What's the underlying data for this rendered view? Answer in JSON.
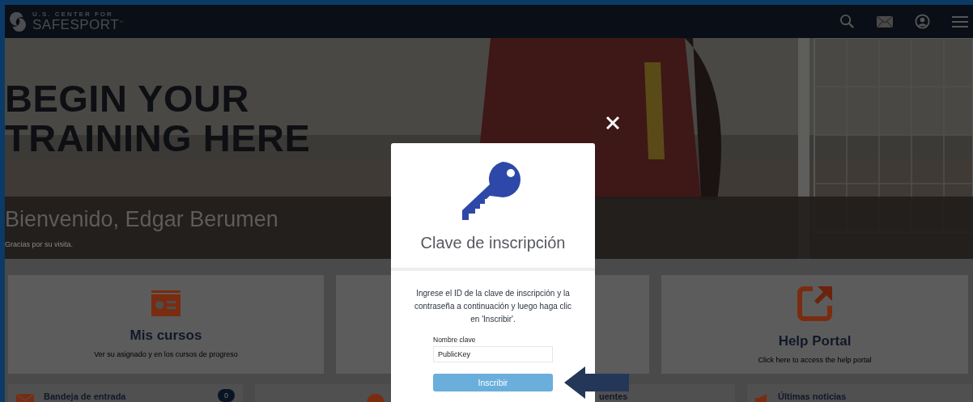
{
  "header": {
    "logo_top": "U.S. CENTER FOR",
    "logo_bottom": "SAFESPORT$^{™}$"
  },
  "hero": {
    "headline": [
      "BEGIN YOUR",
      "TRAINING HERE"
    ],
    "welcome": "Bienvenido, Edgar Berumen",
    "subtitle": "Gracias por su visita."
  },
  "tiles": [
    {
      "kind": "courses",
      "title": "Mis cursos",
      "description": "Ver su asignado y en los cursos de progreso"
    },
    {
      "kind": "covered"
    },
    {
      "kind": "help",
      "title": "Help Portal",
      "description": "Click here to access the help portal"
    }
  ],
  "bottom_cards": [
    {
      "kind": "inbox",
      "title": "Bandeja de entrada",
      "count": "0"
    },
    {
      "kind": "circle"
    },
    {
      "kind": "plain",
      "title": "uentes"
    },
    {
      "kind": "news",
      "title": "Últimas noticias"
    }
  ],
  "modal": {
    "title": "Clave de inscripción",
    "instructions": "Ingrese el ID de la clave de inscripción y la contraseña a continuación y luego haga clic en 'Inscribir'.",
    "field_label": "Nombre clave",
    "field_value": "PublicKey",
    "button": "Inscribir"
  }
}
